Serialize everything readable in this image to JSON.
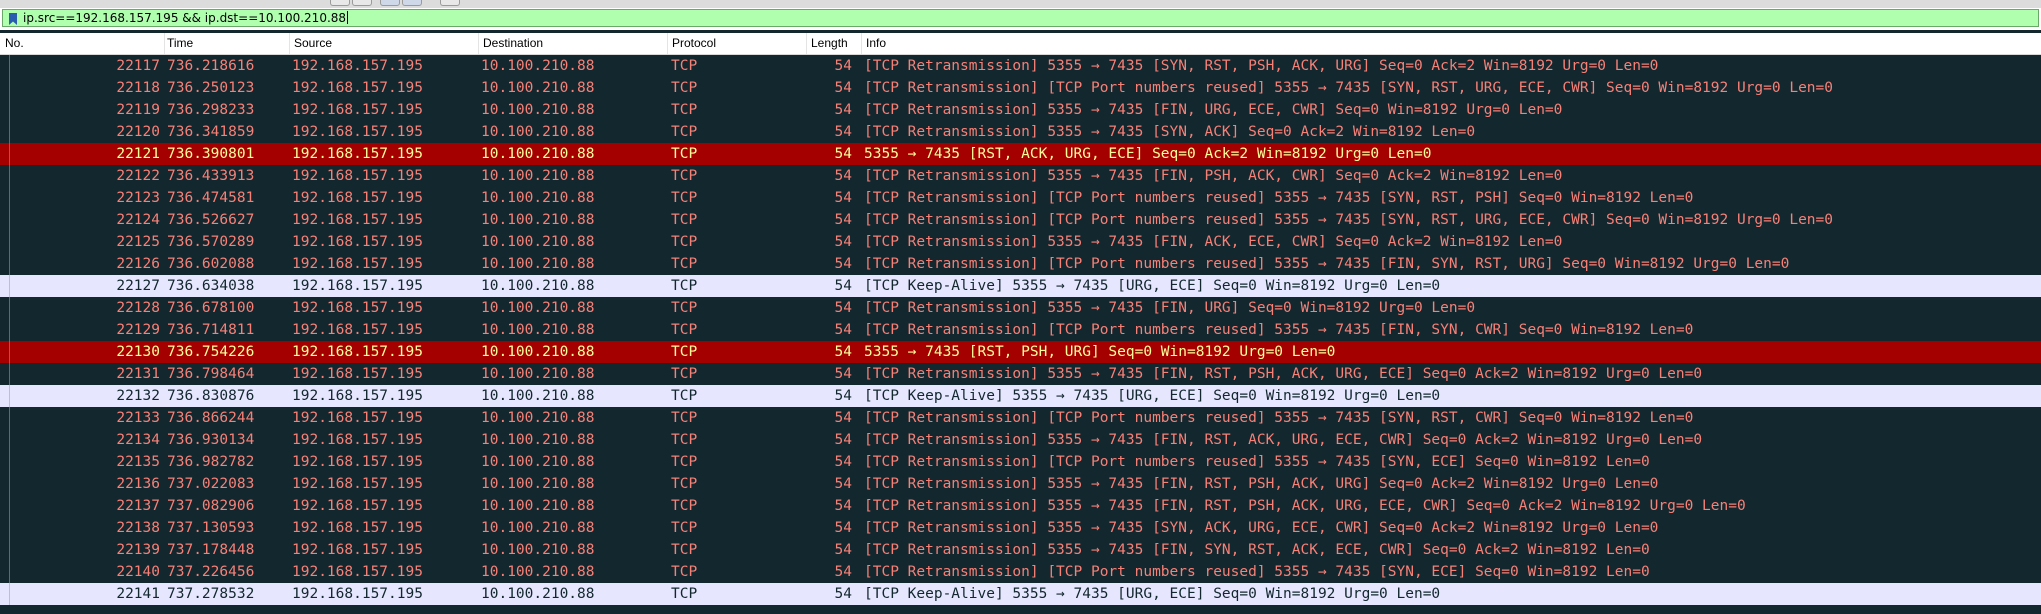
{
  "filter": {
    "value": "ip.src==192.168.157.195 && ip.dst==10.100.210.88"
  },
  "columns": [
    "No.",
    "Time",
    "Source",
    "Destination",
    "Protocol",
    "Length",
    "Info"
  ],
  "packets": [
    {
      "no": "22117",
      "time": "736.218616",
      "src": "192.168.157.195",
      "dst": "10.100.210.88",
      "proto": "TCP",
      "len": "54",
      "info": "[TCP Retransmission] 5355 → 7435 [SYN, RST, PSH, ACK, URG] Seq=0 Ack=2 Win=8192 Urg=0 Len=0",
      "kind": "bad"
    },
    {
      "no": "22118",
      "time": "736.250123",
      "src": "192.168.157.195",
      "dst": "10.100.210.88",
      "proto": "TCP",
      "len": "54",
      "info": "[TCP Retransmission] [TCP Port numbers reused] 5355 → 7435 [SYN, RST, URG, ECE, CWR] Seq=0 Win=8192 Urg=0 Len=0",
      "kind": "bad"
    },
    {
      "no": "22119",
      "time": "736.298233",
      "src": "192.168.157.195",
      "dst": "10.100.210.88",
      "proto": "TCP",
      "len": "54",
      "info": "[TCP Retransmission] 5355 → 7435 [FIN, URG, ECE, CWR] Seq=0 Win=8192 Urg=0 Len=0",
      "kind": "bad"
    },
    {
      "no": "22120",
      "time": "736.341859",
      "src": "192.168.157.195",
      "dst": "10.100.210.88",
      "proto": "TCP",
      "len": "54",
      "info": "[TCP Retransmission] 5355 → 7435 [SYN, ACK] Seq=0 Ack=2 Win=8192 Len=0",
      "kind": "bad"
    },
    {
      "no": "22121",
      "time": "736.390801",
      "src": "192.168.157.195",
      "dst": "10.100.210.88",
      "proto": "TCP",
      "len": "54",
      "info": "5355 → 7435 [RST, ACK, URG, ECE] Seq=0 Ack=2 Win=8192 Urg=0 Len=0",
      "kind": "rst"
    },
    {
      "no": "22122",
      "time": "736.433913",
      "src": "192.168.157.195",
      "dst": "10.100.210.88",
      "proto": "TCP",
      "len": "54",
      "info": "[TCP Retransmission] 5355 → 7435 [FIN, PSH, ACK, CWR] Seq=0 Ack=2 Win=8192 Len=0",
      "kind": "bad"
    },
    {
      "no": "22123",
      "time": "736.474581",
      "src": "192.168.157.195",
      "dst": "10.100.210.88",
      "proto": "TCP",
      "len": "54",
      "info": "[TCP Retransmission] [TCP Port numbers reused] 5355 → 7435 [SYN, RST, PSH] Seq=0 Win=8192 Len=0",
      "kind": "bad"
    },
    {
      "no": "22124",
      "time": "736.526627",
      "src": "192.168.157.195",
      "dst": "10.100.210.88",
      "proto": "TCP",
      "len": "54",
      "info": "[TCP Retransmission] [TCP Port numbers reused] 5355 → 7435 [SYN, RST, URG, ECE, CWR] Seq=0 Win=8192 Urg=0 Len=0",
      "kind": "bad"
    },
    {
      "no": "22125",
      "time": "736.570289",
      "src": "192.168.157.195",
      "dst": "10.100.210.88",
      "proto": "TCP",
      "len": "54",
      "info": "[TCP Retransmission] 5355 → 7435 [FIN, ACK, ECE, CWR] Seq=0 Ack=2 Win=8192 Len=0",
      "kind": "bad"
    },
    {
      "no": "22126",
      "time": "736.602088",
      "src": "192.168.157.195",
      "dst": "10.100.210.88",
      "proto": "TCP",
      "len": "54",
      "info": "[TCP Retransmission] [TCP Port numbers reused] 5355 → 7435 [FIN, SYN, RST, URG] Seq=0 Win=8192 Urg=0 Len=0",
      "kind": "bad"
    },
    {
      "no": "22127",
      "time": "736.634038",
      "src": "192.168.157.195",
      "dst": "10.100.210.88",
      "proto": "TCP",
      "len": "54",
      "info": "[TCP Keep-Alive] 5355 → 7435 [URG, ECE] Seq=0 Win=8192 Urg=0 Len=0",
      "kind": "keepalive"
    },
    {
      "no": "22128",
      "time": "736.678100",
      "src": "192.168.157.195",
      "dst": "10.100.210.88",
      "proto": "TCP",
      "len": "54",
      "info": "[TCP Retransmission] 5355 → 7435 [FIN, URG] Seq=0 Win=8192 Urg=0 Len=0",
      "kind": "bad"
    },
    {
      "no": "22129",
      "time": "736.714811",
      "src": "192.168.157.195",
      "dst": "10.100.210.88",
      "proto": "TCP",
      "len": "54",
      "info": "[TCP Retransmission] [TCP Port numbers reused] 5355 → 7435 [FIN, SYN, CWR] Seq=0 Win=8192 Len=0",
      "kind": "bad"
    },
    {
      "no": "22130",
      "time": "736.754226",
      "src": "192.168.157.195",
      "dst": "10.100.210.88",
      "proto": "TCP",
      "len": "54",
      "info": "5355 → 7435 [RST, PSH, URG] Seq=0 Win=8192 Urg=0 Len=0",
      "kind": "rst"
    },
    {
      "no": "22131",
      "time": "736.798464",
      "src": "192.168.157.195",
      "dst": "10.100.210.88",
      "proto": "TCP",
      "len": "54",
      "info": "[TCP Retransmission] 5355 → 7435 [FIN, RST, PSH, ACK, URG, ECE] Seq=0 Ack=2 Win=8192 Urg=0 Len=0",
      "kind": "bad"
    },
    {
      "no": "22132",
      "time": "736.830876",
      "src": "192.168.157.195",
      "dst": "10.100.210.88",
      "proto": "TCP",
      "len": "54",
      "info": "[TCP Keep-Alive] 5355 → 7435 [URG, ECE] Seq=0 Win=8192 Urg=0 Len=0",
      "kind": "keepalive"
    },
    {
      "no": "22133",
      "time": "736.866244",
      "src": "192.168.157.195",
      "dst": "10.100.210.88",
      "proto": "TCP",
      "len": "54",
      "info": "[TCP Retransmission] [TCP Port numbers reused] 5355 → 7435 [SYN, RST, CWR] Seq=0 Win=8192 Len=0",
      "kind": "bad"
    },
    {
      "no": "22134",
      "time": "736.930134",
      "src": "192.168.157.195",
      "dst": "10.100.210.88",
      "proto": "TCP",
      "len": "54",
      "info": "[TCP Retransmission] 5355 → 7435 [FIN, RST, ACK, URG, ECE, CWR] Seq=0 Ack=2 Win=8192 Urg=0 Len=0",
      "kind": "bad"
    },
    {
      "no": "22135",
      "time": "736.982782",
      "src": "192.168.157.195",
      "dst": "10.100.210.88",
      "proto": "TCP",
      "len": "54",
      "info": "[TCP Retransmission] [TCP Port numbers reused] 5355 → 7435 [SYN, ECE] Seq=0 Win=8192 Len=0",
      "kind": "bad"
    },
    {
      "no": "22136",
      "time": "737.022083",
      "src": "192.168.157.195",
      "dst": "10.100.210.88",
      "proto": "TCP",
      "len": "54",
      "info": "[TCP Retransmission] 5355 → 7435 [FIN, RST, PSH, ACK, URG] Seq=0 Ack=2 Win=8192 Urg=0 Len=0",
      "kind": "bad"
    },
    {
      "no": "22137",
      "time": "737.082906",
      "src": "192.168.157.195",
      "dst": "10.100.210.88",
      "proto": "TCP",
      "len": "54",
      "info": "[TCP Retransmission] 5355 → 7435 [FIN, RST, PSH, ACK, URG, ECE, CWR] Seq=0 Ack=2 Win=8192 Urg=0 Len=0",
      "kind": "bad"
    },
    {
      "no": "22138",
      "time": "737.130593",
      "src": "192.168.157.195",
      "dst": "10.100.210.88",
      "proto": "TCP",
      "len": "54",
      "info": "[TCP Retransmission] 5355 → 7435 [SYN, ACK, URG, ECE, CWR] Seq=0 Ack=2 Win=8192 Urg=0 Len=0",
      "kind": "bad"
    },
    {
      "no": "22139",
      "time": "737.178448",
      "src": "192.168.157.195",
      "dst": "10.100.210.88",
      "proto": "TCP",
      "len": "54",
      "info": "[TCP Retransmission] 5355 → 7435 [FIN, SYN, RST, ACK, ECE, CWR] Seq=0 Ack=2 Win=8192 Len=0",
      "kind": "bad"
    },
    {
      "no": "22140",
      "time": "737.226456",
      "src": "192.168.157.195",
      "dst": "10.100.210.88",
      "proto": "TCP",
      "len": "54",
      "info": "[TCP Retransmission] [TCP Port numbers reused] 5355 → 7435 [SYN, ECE] Seq=0 Win=8192 Len=0",
      "kind": "bad"
    },
    {
      "no": "22141",
      "time": "737.278532",
      "src": "192.168.157.195",
      "dst": "10.100.210.88",
      "proto": "TCP",
      "len": "54",
      "info": "[TCP Keep-Alive] 5355 → 7435 [URG, ECE] Seq=0 Win=8192 Urg=0 Len=0",
      "kind": "keepalive"
    }
  ],
  "colors": {
    "bad_bg": "#12272e",
    "bad_fg": "#f78077",
    "rst_bg": "#a40000",
    "rst_fg": "#fffc9c",
    "keepalive_bg": "#e7e6ff",
    "keepalive_fg": "#12272e",
    "filter_bg": "#afffaf"
  }
}
